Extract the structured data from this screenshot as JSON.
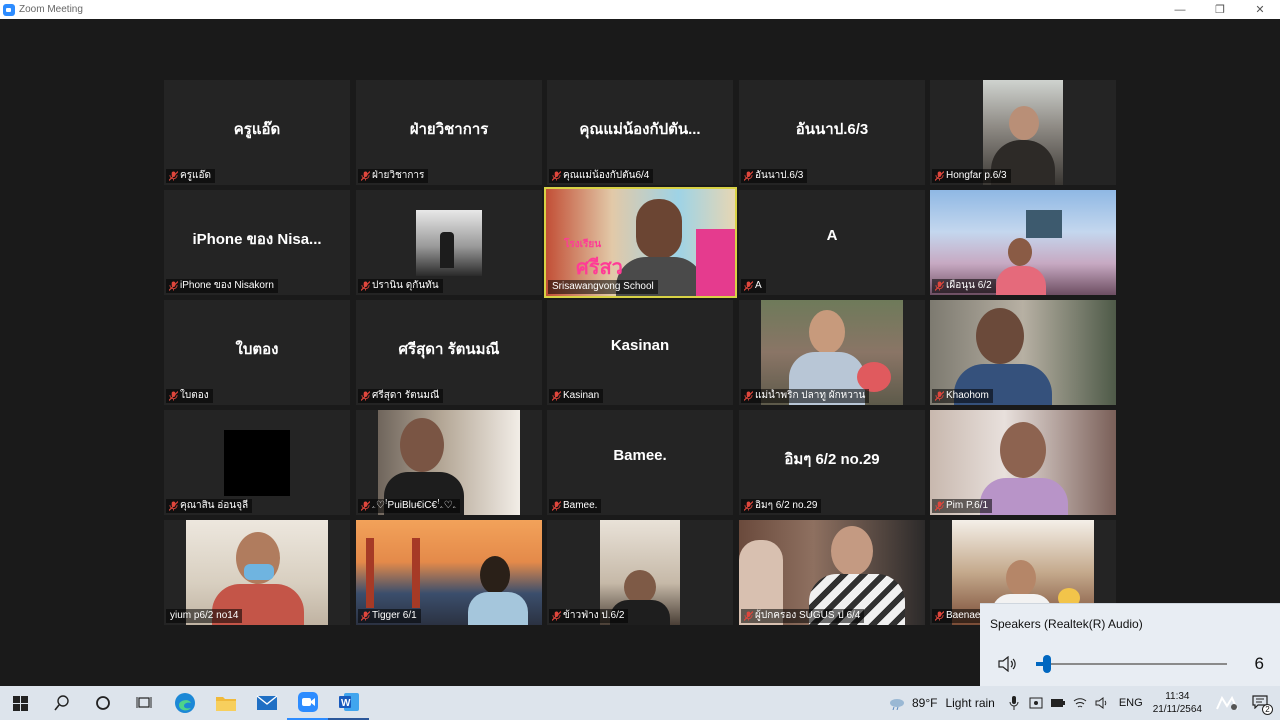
{
  "window": {
    "title": "Zoom Meeting",
    "minimize": "—",
    "maximize": "❐",
    "close": "✕"
  },
  "tiles": [
    {
      "name": "ครูแอ๊ด",
      "label": "ครูแอ๊ด",
      "muted": true
    },
    {
      "name": "ฝ่ายวิชาการ",
      "label": "ฝ่ายวิชาการ",
      "muted": true
    },
    {
      "name": "คุณแม่น้องกัปตัน...",
      "label": "คุณแม่น้องกัปตัน6/4",
      "muted": true
    },
    {
      "name": "อันนาป.6/3",
      "label": "อันนาป.6/3",
      "muted": true
    },
    {
      "name": "",
      "label": "Hongfar p.6/3",
      "muted": true
    },
    {
      "name": "iPhone ของ Nisa...",
      "label": "iPhone ของ Nisakorn",
      "muted": true
    },
    {
      "name": "",
      "label": "ปรานิน ดุกันทัน",
      "muted": true
    },
    {
      "name": "",
      "label": "Srisawangvong School",
      "muted": false,
      "overlay_line1": "โรงเรียน",
      "overlay_line2": "ศรีสว"
    },
    {
      "name": "A",
      "label": "A",
      "muted": true
    },
    {
      "name": "",
      "label": "เผือนุน 6/2",
      "muted": true
    },
    {
      "name": "ใบตอง",
      "label": "ใบตอง",
      "muted": true
    },
    {
      "name": "ศรีสุดา รัตนมณี",
      "label": "ศรีสุดา รัตนมณี",
      "muted": true
    },
    {
      "name": "Kasinan",
      "label": "Kasinan",
      "muted": true
    },
    {
      "name": "",
      "label": "แม่น้ำพริก ปลาทู ผักหวาน",
      "muted": true
    },
    {
      "name": "",
      "label": "Khaohom",
      "muted": true
    },
    {
      "name": "",
      "label": "คุณาสิน อ่อนจุลี",
      "muted": true
    },
    {
      "name": "",
      "label": "ۦ♡ꜝPuiBlu€iC€ꜝۦ♡ۦ",
      "muted": true
    },
    {
      "name": "Bamee.",
      "label": "Bamee.",
      "muted": true
    },
    {
      "name": "อิมๆ 6/2 no.29",
      "label": "อิมๆ 6/2 no.29",
      "muted": true
    },
    {
      "name": "",
      "label": "Pim P.6/1",
      "muted": true
    },
    {
      "name": "",
      "label": "yium p6/2 no14",
      "muted": false
    },
    {
      "name": "",
      "label": "Tigger 6/1",
      "muted": true
    },
    {
      "name": "",
      "label": "ข้าวฟ่าง ป.6/2",
      "muted": true
    },
    {
      "name": "",
      "label": "ผู้ปกครอง SUGUS ป 6/4",
      "muted": true
    },
    {
      "name": "",
      "label": "Baenae",
      "muted": true
    }
  ],
  "volume": {
    "device": "Speakers (Realtek(R) Audio)",
    "level": "6",
    "fraction": 0.06
  },
  "taskbar": {
    "weather_temp": "89°F",
    "weather_desc": "Light rain",
    "lang": "ENG",
    "time": "11:34",
    "date": "21/11/2564",
    "notif_count": "2"
  },
  "colors": {
    "zoom_blue": "#2d8cff",
    "active_speaker": "#d8d245",
    "mute_red": "#e0463c"
  }
}
